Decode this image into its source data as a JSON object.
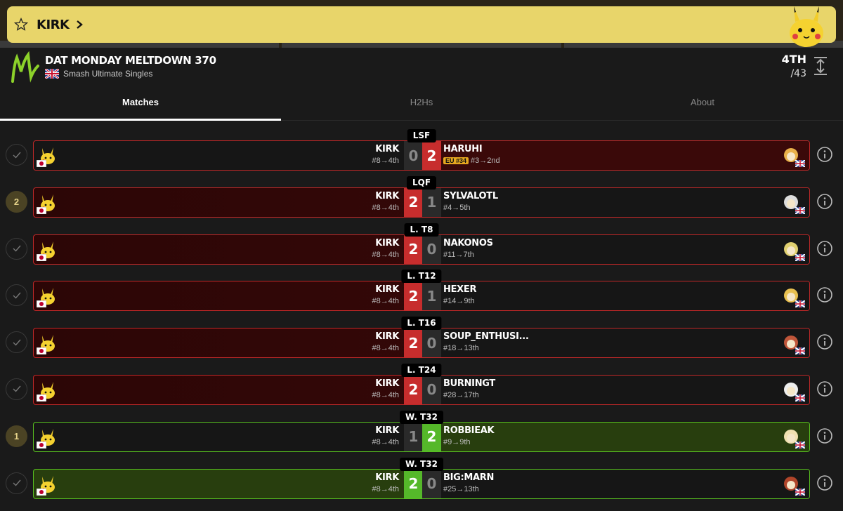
{
  "player": {
    "name": "KIRK"
  },
  "tournament": {
    "title": "DAT MONDAY MELTDOWN 370",
    "game": "Smash Ultimate Singles",
    "placement": "4TH",
    "entrants": "/43"
  },
  "tabs": [
    "Matches",
    "H2Hs",
    "About"
  ],
  "colors": {
    "loss": "#c72d2d",
    "win": "#55b82a",
    "gold": "#e8d56a"
  },
  "matches": [
    {
      "round": "LSF",
      "status": "check",
      "left": {
        "name": "KIRK",
        "seed": "#8→4th",
        "score": "0"
      },
      "right": {
        "name": "HARUHI",
        "badge": "EU #34",
        "seed": "#3→2nd",
        "score": "2"
      },
      "result": "loss"
    },
    {
      "round": "LQF",
      "status": "2",
      "left": {
        "name": "KIRK",
        "seed": "#8→4th",
        "score": "2"
      },
      "right": {
        "name": "SYLVALOTL",
        "seed": "#4→5th",
        "score": "1"
      },
      "result": "win-red"
    },
    {
      "round": "L. T8",
      "status": "check",
      "left": {
        "name": "KIRK",
        "seed": "#8→4th",
        "score": "2"
      },
      "right": {
        "name": "NAKONOS",
        "seed": "#11→7th",
        "score": "0"
      },
      "result": "win-red"
    },
    {
      "round": "L. T12",
      "status": "check",
      "left": {
        "name": "KIRK",
        "seed": "#8→4th",
        "score": "2"
      },
      "right": {
        "name": "HEXER",
        "seed": "#14→9th",
        "score": "1"
      },
      "result": "win-red"
    },
    {
      "round": "L. T16",
      "status": "check",
      "left": {
        "name": "KIRK",
        "seed": "#8→4th",
        "score": "2"
      },
      "right": {
        "name": "SOUP_ENTHUSI...",
        "seed": "#18→13th",
        "score": "0"
      },
      "result": "win-red"
    },
    {
      "round": "L. T24",
      "status": "check",
      "left": {
        "name": "KIRK",
        "seed": "#8→4th",
        "score": "2"
      },
      "right": {
        "name": "BURNINGT",
        "seed": "#28→17th",
        "score": "0"
      },
      "result": "win-red"
    },
    {
      "round": "W. T32",
      "status": "1",
      "left": {
        "name": "KIRK",
        "seed": "#8→4th",
        "score": "1"
      },
      "right": {
        "name": "ROBBIEAK",
        "seed": "#9→9th",
        "score": "2"
      },
      "result": "loss-green"
    },
    {
      "round": "W. T32",
      "status": "check",
      "left": {
        "name": "KIRK",
        "seed": "#8→4th",
        "score": "2"
      },
      "right": {
        "name": "BIG:MARN",
        "seed": "#25→13th",
        "score": "0"
      },
      "result": "win-green"
    }
  ]
}
